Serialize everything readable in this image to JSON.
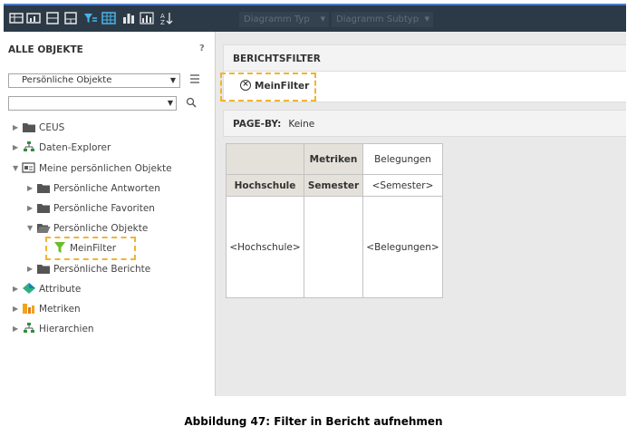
{
  "toolbar": {
    "icons": [
      "grid-view-icon",
      "graph-view-icon",
      "page-icon",
      "page-icon",
      "filter-icon",
      "table-icon",
      "bar-chart-icon",
      "column-chart-icon",
      "sort-icon"
    ],
    "chart_type": "Diagramm Typ",
    "chart_subtype": "Diagramm Subtyp"
  },
  "sidebar": {
    "title": "ALLE OBJEKTE",
    "help": "?",
    "selected_view": "Persönliche Objekte",
    "search_value": "",
    "tree": [
      {
        "label": "CEUS",
        "icon": "folder"
      },
      {
        "label": "Daten-Explorer",
        "icon": "hierarchy"
      },
      {
        "label": "Meine persönlichen Objekte",
        "icon": "personal"
      },
      {
        "label": "Persönliche Antworten",
        "icon": "folder"
      },
      {
        "label": "Persönliche Favoriten",
        "icon": "folder"
      },
      {
        "label": "Persönliche Objekte",
        "icon": "folder-open"
      },
      {
        "label": "MeinFilter",
        "icon": "filter"
      },
      {
        "label": "Persönliche Berichte",
        "icon": "folder"
      },
      {
        "label": "Attribute",
        "icon": "attribute"
      },
      {
        "label": "Metriken",
        "icon": "metric"
      },
      {
        "label": "Hierarchien",
        "icon": "hierarchy"
      }
    ]
  },
  "main": {
    "report_filter_title": "BERICHTSFILTER",
    "filter_chip": "MeinFilter",
    "pageby_label": "PAGE-BY:",
    "pageby_value": "Keine",
    "grid": {
      "metrics_header": "Metriken",
      "belegungen_header": "Belegungen",
      "hochschule": "Hochschule",
      "semester": "Semester",
      "semester_placeholder": "<Semester>",
      "hochschule_placeholder": "<Hochschule>",
      "belegungen_placeholder": "<Belegungen>"
    }
  },
  "caption": "Abbildung 47: Filter in Bericht aufnehmen",
  "colors": {
    "toolbar": "#2c3a47",
    "highlight": "#f2b431",
    "grid_header": "#e4e1da"
  }
}
